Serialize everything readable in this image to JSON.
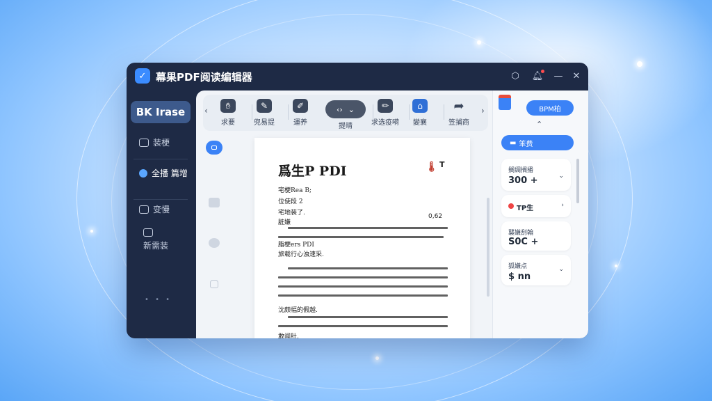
{
  "window": {
    "title": "幕果PDF阅读编辑器"
  },
  "sidebar": {
    "primary_label": "BK Irase",
    "items": [
      {
        "label": "装梗",
        "icon": "folder-icon"
      },
      {
        "label": "全播 篇增",
        "icon": "clock-icon"
      },
      {
        "label": "变慢",
        "icon": "document-icon"
      },
      {
        "label": "新需装",
        "icon": "screen-icon"
      }
    ]
  },
  "toolbar": {
    "tools": [
      {
        "label": "求要",
        "icon": "hand-icon"
      },
      {
        "label": "兜易提",
        "icon": "pen-icon"
      },
      {
        "label": "運养",
        "icon": "edit-icon"
      },
      {
        "label": "提晴",
        "icon": "code-icon"
      },
      {
        "label": "求选疫嗬",
        "icon": "pencil-icon"
      },
      {
        "label": "變襄",
        "icon": "stamp-icon"
      },
      {
        "label": "笠捕商",
        "icon": "share-icon"
      }
    ]
  },
  "document": {
    "title": "爲生P PDI",
    "flag": "T",
    "meta_lines": [
      "宅梗Rea B;",
      "位使段 2",
      "宅地装了.",
      "脏嫌"
    ],
    "right_meta": "0,62",
    "para1_tail": "旅载行心浊速采.",
    "para1_sub": "脂梗ers PDI",
    "para2_tail": "沈颇幅的假越.",
    "para3_tail": "敢闻肚."
  },
  "right_panel": {
    "pill_label": "BPM柏",
    "select_label": "笨费",
    "cards": [
      {
        "label": "搁绸搁播",
        "value": "300 +"
      },
      {
        "label": "TP生",
        "value": ""
      },
      {
        "label": "襲嫌刮翰",
        "value": "S0C +"
      },
      {
        "label": "狐嫌点",
        "value": "$ nn"
      }
    ]
  },
  "colors": {
    "accent": "#3b82f6",
    "window_bg": "#1e2a45",
    "alert": "#ef4444"
  }
}
